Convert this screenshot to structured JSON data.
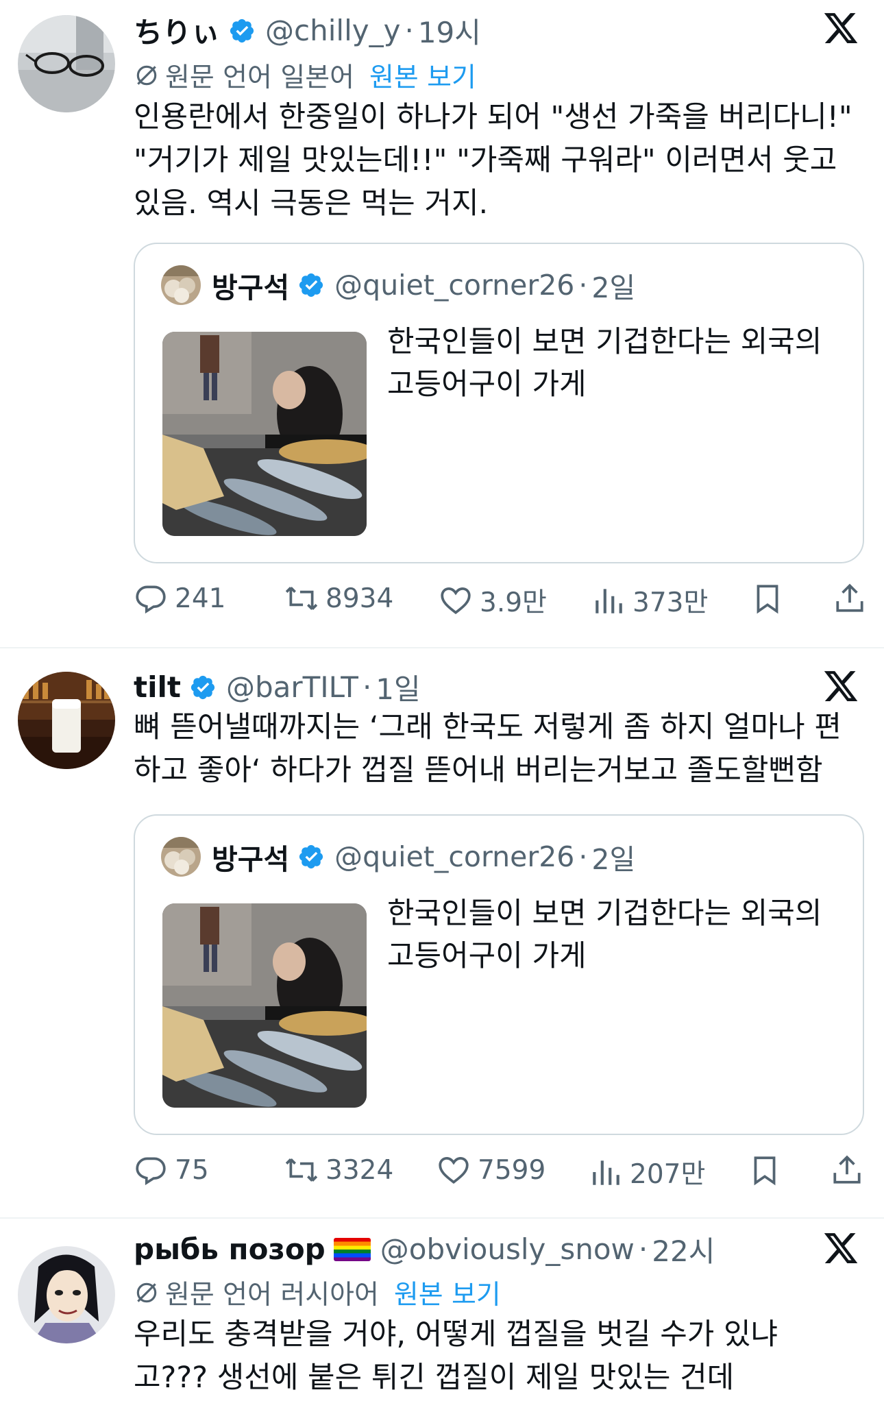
{
  "tweets": [
    {
      "name": "ちりぃ",
      "handle": "@chilly_y",
      "time": "19시",
      "translate": {
        "label": "원문 언어 일본어",
        "link": "원본 보기"
      },
      "body": [
        "인용란에서 한중일이 하나가 되어 \"생선 가죽을 버리다니!\"",
        "\"거기가 제일 맛있는데!!\" \"가죽째 구워라\" 이러면서 웃고",
        "있음. 역시 극동은 먹는 거지."
      ],
      "quote": {
        "name": "방구석",
        "handle": "@quiet_corner26",
        "time": "2일",
        "text": [
          "한국인들이 보면 기겁한다는 외국의",
          "고등어구이 가게"
        ]
      },
      "stats": {
        "replies": "241",
        "retweets": "8934",
        "likes": "3.9만",
        "views": "373만"
      }
    },
    {
      "name": "tilt",
      "handle": "@barTILT",
      "time": "1일",
      "body": [
        "뼈 뜯어낼때까지는 ‘그래 한국도 저렇게 좀 하지 얼마나 편",
        "하고 좋아‘ 하다가 껍질 뜯어내 버리는거보고 졸도할뻔함"
      ],
      "quote": {
        "name": "방구석",
        "handle": "@quiet_corner26",
        "time": "2일",
        "text": [
          "한국인들이 보면 기겁한다는 외국의",
          "고등어구이 가게"
        ]
      },
      "stats": {
        "replies": "75",
        "retweets": "3324",
        "likes": "7599",
        "views": "207만"
      }
    },
    {
      "name": "рыбь позор",
      "name_emoji": "🏳️‍🌈",
      "handle": "@obviously_snow",
      "time": "22시",
      "translate": {
        "label": "원문 언어 러시아어",
        "link": "원본 보기"
      },
      "body": [
        "우리도 충격받을 거야, 어떻게 껍질을 벗길 수가 있냐",
        "고??? 생선에 붙은 튀긴 껍질이 제일 맛있는 건데"
      ]
    }
  ],
  "separator": "·",
  "colors": {
    "accent": "#1d9bf0",
    "text": "#0f1419",
    "muted": "#536471",
    "border": "#cfd9de"
  },
  "icons": [
    "verified-badge-icon",
    "x-logo-icon",
    "translate-globe-icon",
    "reply-icon",
    "retweet-icon",
    "like-icon",
    "views-icon",
    "bookmark-icon",
    "share-icon"
  ]
}
